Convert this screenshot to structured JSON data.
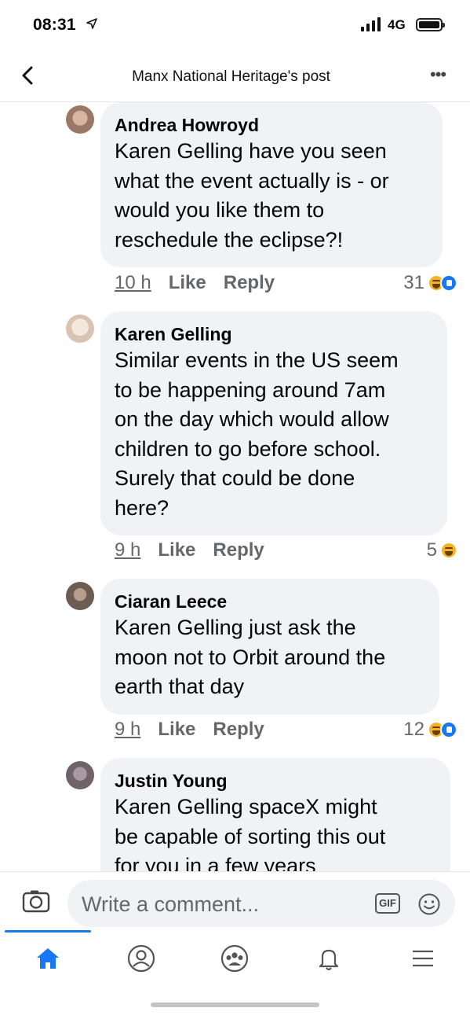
{
  "status_bar": {
    "time": "08:31",
    "network": "4G"
  },
  "header": {
    "title": "Manx National Heritage's post"
  },
  "comments": [
    {
      "author": "Andrea Howroyd",
      "text": [
        "Karen Gelling have you seen",
        "what the event actually is - or",
        "would you like them to",
        "reschedule the eclipse?!"
      ],
      "time": "10 h",
      "like_label": "Like",
      "reply_label": "Reply",
      "reaction_count": "31"
    },
    {
      "author": "Karen Gelling",
      "text": [
        "Similar events in the US seem",
        "to be happening around 7am",
        "on the day which would allow",
        "children to go before school.",
        "Surely that could be done",
        "here?"
      ],
      "time": "9 h",
      "like_label": "Like",
      "reply_label": "Reply",
      "reaction_count": "5"
    },
    {
      "author": "Ciaran Leece",
      "text": [
        "Karen Gelling  just ask the",
        "moon not to Orbit around the",
        "earth that day"
      ],
      "time": "9 h",
      "like_label": "Like",
      "reply_label": "Reply",
      "reaction_count": "12"
    },
    {
      "author": "Justin Young",
      "text": [
        "Karen Gelling spaceX might",
        "be capable of sorting this out",
        "for you in a few years"
      ],
      "time": "",
      "like_label": "",
      "reply_label": "",
      "reaction_count": ""
    }
  ],
  "composer": {
    "placeholder": "Write a comment...",
    "gif_label": "GIF"
  },
  "nav": {
    "items": [
      "home-icon",
      "profile-icon",
      "groups-icon",
      "notifications-icon",
      "menu-icon"
    ]
  },
  "colors": {
    "accent": "#1877f2",
    "bubble": "#f0f2f5",
    "muted": "#65676b"
  }
}
